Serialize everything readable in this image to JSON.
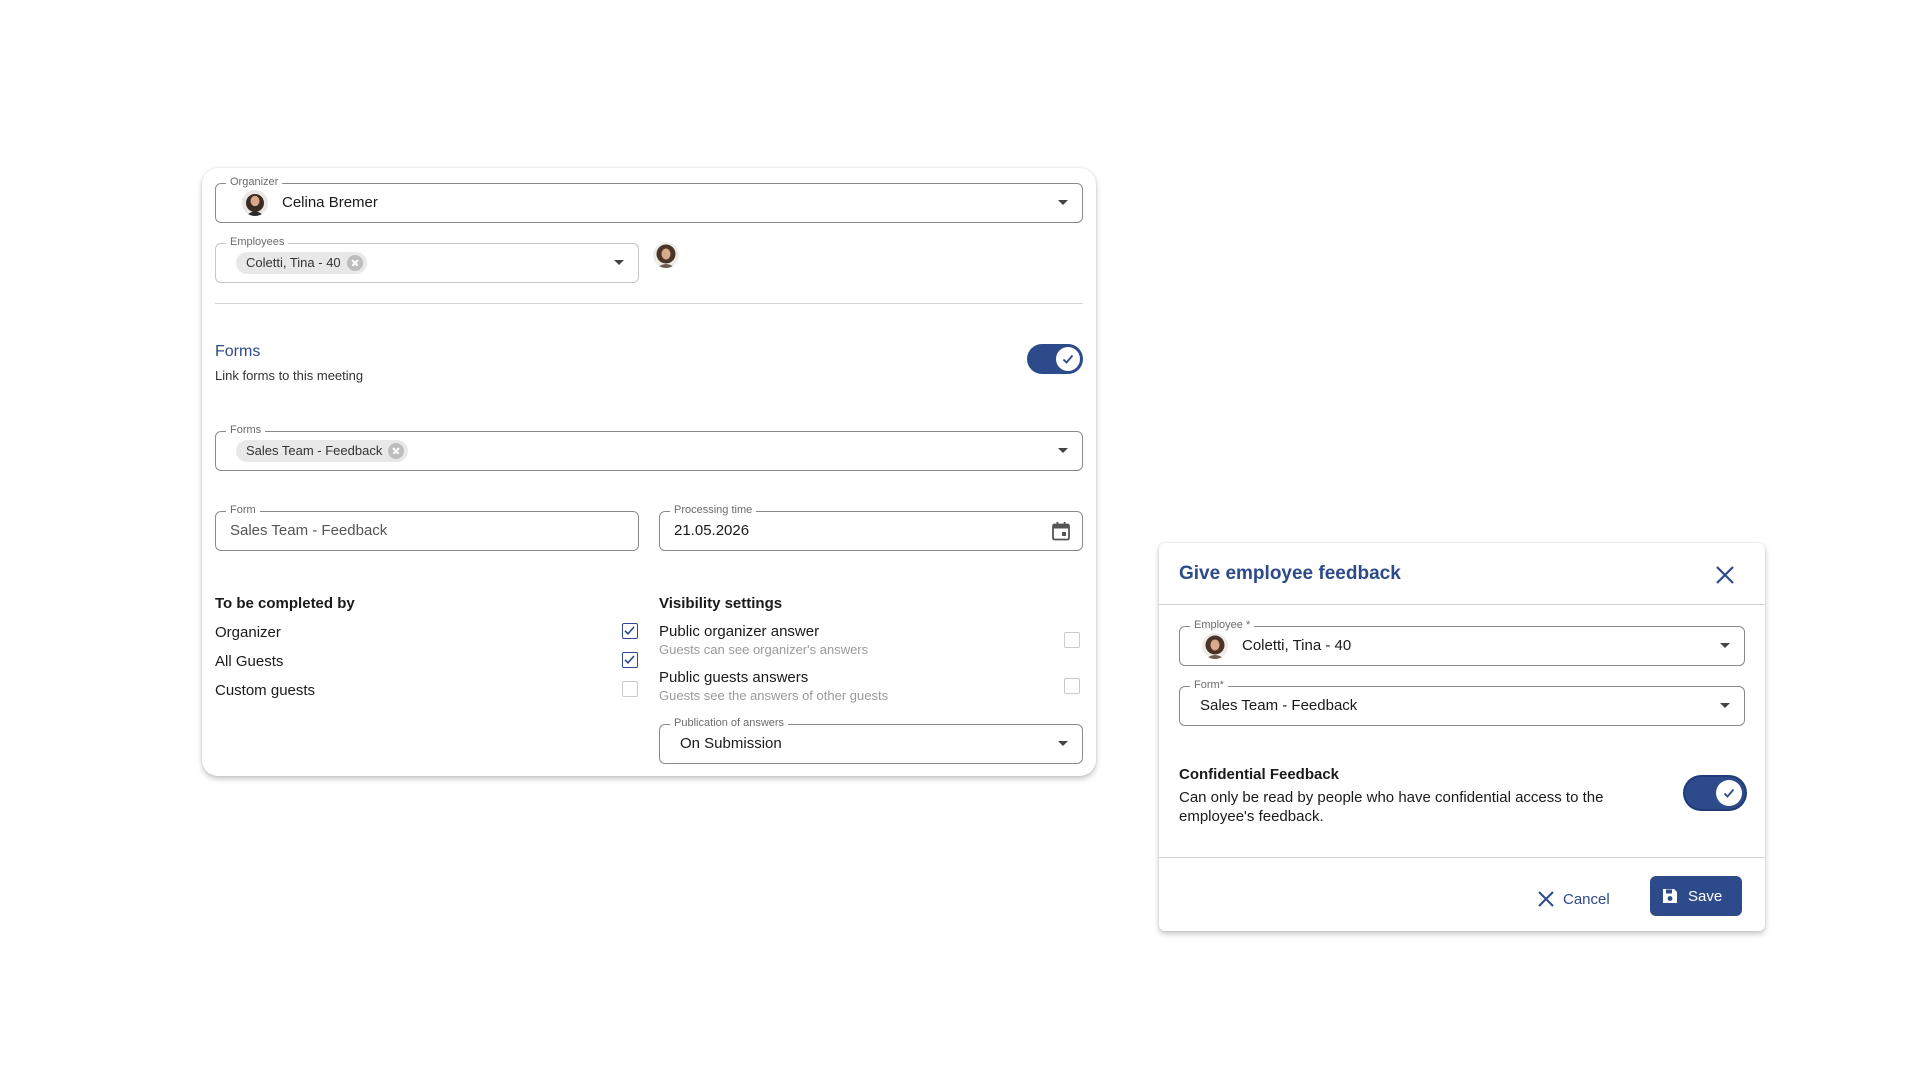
{
  "meeting": {
    "organizer": {
      "label": "Organizer",
      "value": "Celina Bremer"
    },
    "employees": {
      "label": "Employees",
      "chips": [
        "Coletti, Tina - 40"
      ]
    },
    "forms_section": {
      "title": "Forms",
      "subtitle": "Link forms to this meeting",
      "enabled": true
    },
    "forms_field": {
      "label": "Forms",
      "chips": [
        "Sales Team - Feedback"
      ]
    },
    "form_field": {
      "label": "Form",
      "value": "Sales Team - Feedback"
    },
    "processing_time": {
      "label": "Processing time",
      "value": "21.05.2026"
    },
    "completed_by": {
      "title": "To be completed by",
      "items": [
        {
          "label": "Organizer",
          "checked": true
        },
        {
          "label": "All Guests",
          "checked": true
        },
        {
          "label": "Custom guests",
          "checked": false
        }
      ]
    },
    "visibility": {
      "title": "Visibility settings",
      "items": [
        {
          "label": "Public organizer answer",
          "sub": "Guests can see organizer's answers",
          "checked": false
        },
        {
          "label": "Public guests answers",
          "sub": "Guests see the answers of other guests",
          "checked": false
        }
      ],
      "publication": {
        "label": "Publication of answers",
        "value": "On Submission"
      }
    }
  },
  "dialog": {
    "title": "Give employee feedback",
    "employee": {
      "label": "Employee",
      "required": "*",
      "value": "Coletti, Tina - 40"
    },
    "form": {
      "label": "Form",
      "required": "*",
      "value": "Sales Team - Feedback"
    },
    "confidential": {
      "title": "Confidential Feedback",
      "description": "Can only be read by people who have confidential access to the employee's feedback.",
      "enabled": true
    },
    "cancel_label": "Cancel",
    "save_label": "Save"
  },
  "colors": {
    "primary": "#2d4a8a",
    "border": "#c6c6c6",
    "muted": "#9a9a9a"
  },
  "icons": [
    "chevron-down-icon",
    "calendar-icon",
    "check-icon",
    "close-icon",
    "save-icon",
    "avatar"
  ]
}
